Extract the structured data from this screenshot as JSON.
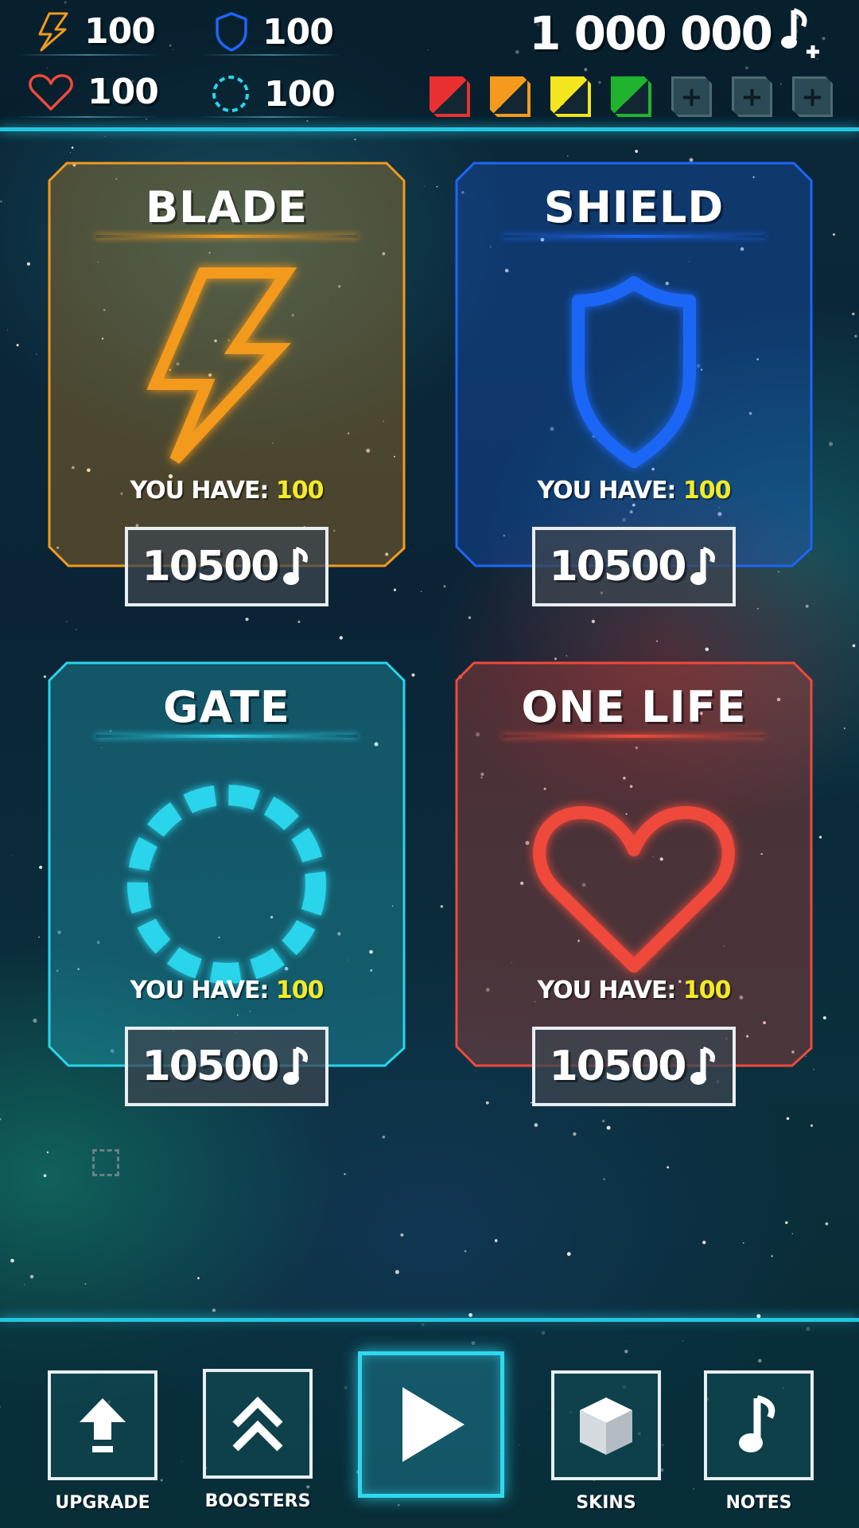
{
  "hud": {
    "stats": [
      {
        "icon": "lightning-icon",
        "value": "100",
        "color": "#f39a1c"
      },
      {
        "icon": "shield-icon",
        "value": "100",
        "color": "#1e66f5"
      },
      {
        "icon": "heart-icon",
        "value": "100",
        "color": "#ef4a3a"
      },
      {
        "icon": "gate-ring-icon",
        "value": "100",
        "color": "#2ad4ea"
      }
    ],
    "coins": "1 000 000",
    "coin_icon": "note-plus-icon",
    "slots": [
      {
        "type": "color",
        "color": "#e8312f"
      },
      {
        "type": "color",
        "color": "#f59a1c"
      },
      {
        "type": "color",
        "color": "#f3e51e"
      },
      {
        "type": "color",
        "color": "#1fb32e"
      },
      {
        "type": "add",
        "label": "+"
      },
      {
        "type": "add",
        "label": "+"
      },
      {
        "type": "add",
        "label": "+"
      }
    ]
  },
  "cards": [
    {
      "title": "BLADE",
      "have_label": "YOU HAVE:",
      "have_value": "100",
      "price": "10500",
      "color": "#f39a1c",
      "icon": "lightning-icon"
    },
    {
      "title": "SHIELD",
      "have_label": "YOU HAVE:",
      "have_value": "100",
      "price": "10500",
      "color": "#1e66f5",
      "icon": "shield-icon"
    },
    {
      "title": "GATE",
      "have_label": "YOU HAVE:",
      "have_value": "100",
      "price": "10500",
      "color": "#2ad4ea",
      "icon": "gate-ring-icon"
    },
    {
      "title": "ONE LIFE",
      "have_label": "YOU HAVE:",
      "have_value": "100",
      "price": "10500",
      "color": "#ef4a3a",
      "icon": "heart-icon"
    }
  ],
  "nav": {
    "upgrade": "UPGRADE",
    "boosters": "BOOSTERS",
    "skins": "SKINS",
    "notes": "NOTES"
  },
  "colors": {
    "accent": "#24c6e0",
    "highlight": "#f3ea28"
  }
}
